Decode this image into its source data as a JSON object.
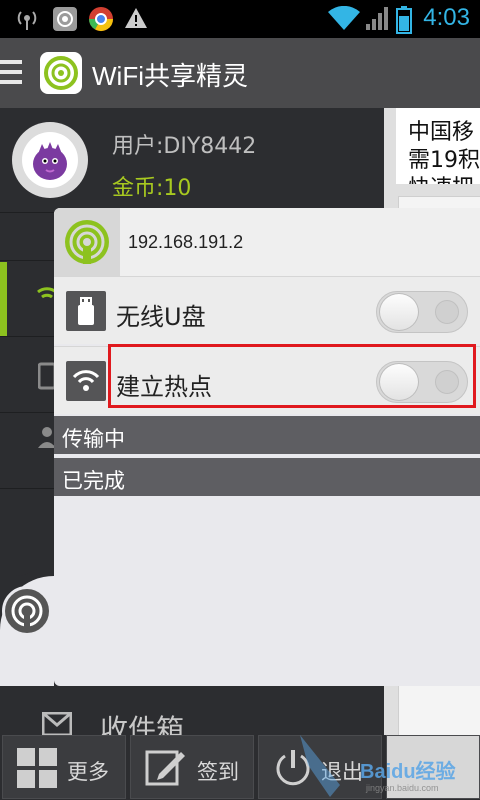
{
  "status_bar": {
    "time": "4:03",
    "icons": [
      "broadcast-icon",
      "app-notification-icon",
      "chrome-icon",
      "warning-icon",
      "wifi-signal-icon",
      "cell-signal-icon",
      "battery-icon"
    ]
  },
  "title_bar": {
    "title": "WiFi共享精灵"
  },
  "drawer": {
    "user_label": "用户:DIY8442",
    "coins_label": "金币:10",
    "inbox_label": "收件箱"
  },
  "behind_content": {
    "line1": "中国移",
    "line2": "需19积",
    "line3": "快速把"
  },
  "popup": {
    "ip": "192.168.191.2",
    "rows": [
      {
        "label": "无线U盘",
        "icon": "usb-drive-icon",
        "toggle_on": false
      },
      {
        "label": "建立热点",
        "icon": "wifi-icon",
        "toggle_on": false
      }
    ],
    "sections": [
      {
        "label": "传输中"
      },
      {
        "label": "已完成"
      }
    ]
  },
  "bottom_bar": {
    "more_label": "更多",
    "signin_label": "签到",
    "exit_label": "退出"
  },
  "watermark": {
    "text": "Baidu经验",
    "sub": "jingyan.baidu.com"
  },
  "colors": {
    "accent_green": "#8dc21f",
    "coins_green": "#a8c920",
    "highlight_red": "#e0191e",
    "status_blue": "#33b5e5"
  }
}
